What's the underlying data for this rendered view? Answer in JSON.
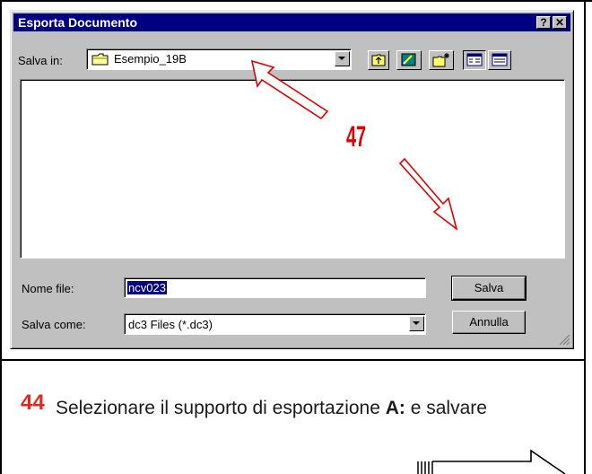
{
  "dialog": {
    "title": "Esporta Documento",
    "help_button": "?",
    "close_button": "✕",
    "save_in_label": "Salva in:",
    "save_in_folder": "Esempio_19B",
    "file_name_label": "Nome file:",
    "file_name_value": "ncv023",
    "save_as_label": "Salva come:",
    "save_as_value": "dc3 Files (*.dc3)",
    "save_button": "Salva",
    "cancel_button": "Annulla",
    "toolbar_icons": [
      "up-folder-icon",
      "desktop-icon",
      "new-folder-icon",
      "list-view-icon",
      "details-view-icon"
    ]
  },
  "annotation": {
    "callout_number": "47"
  },
  "instruction": {
    "step_number": "44",
    "text_before": "Selezionare il supporto di esportazione ",
    "text_bold": "A:",
    "text_after": " e salvare"
  },
  "colors": {
    "titlebar": "#000080",
    "face": "#c0c0c0",
    "callout_red": "#e00000",
    "step_red": "#e0281f"
  }
}
